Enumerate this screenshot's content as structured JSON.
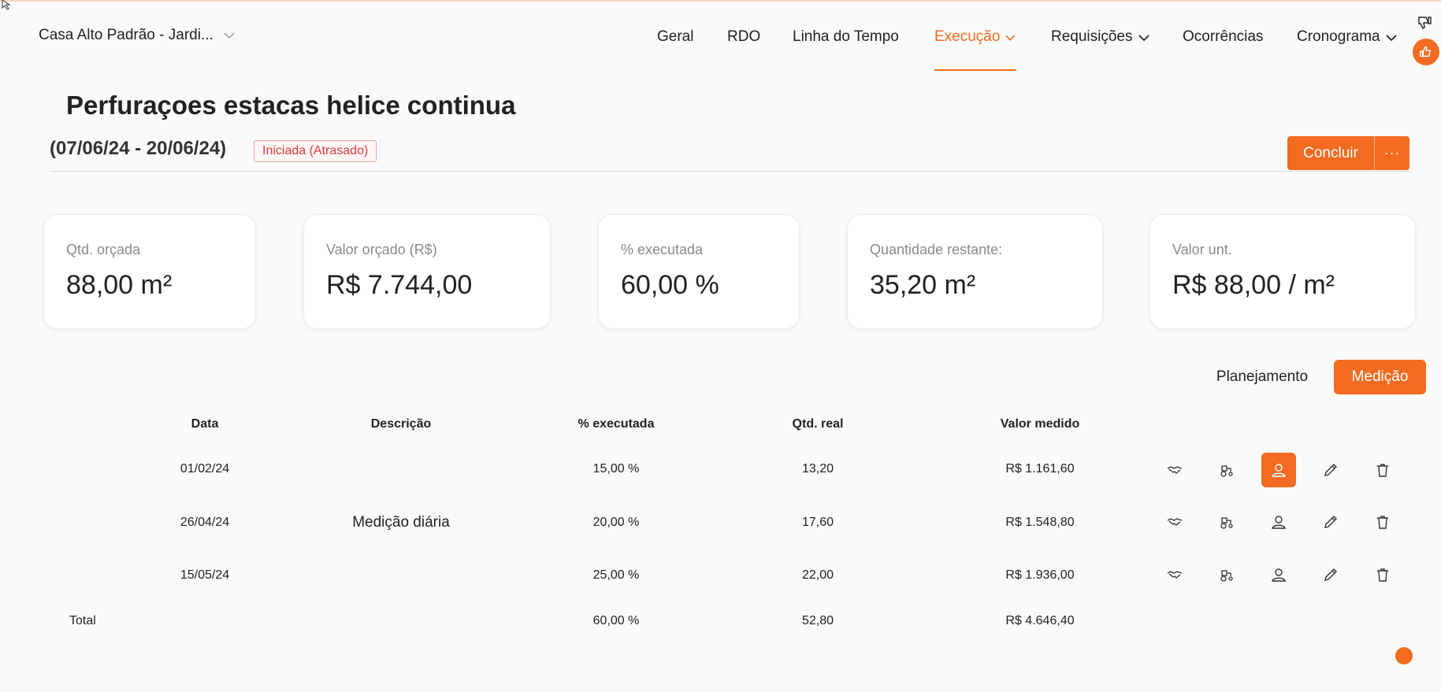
{
  "header": {
    "project_name": "Casa Alto Padrão - Jardi...",
    "nav": [
      {
        "label": "Geral"
      },
      {
        "label": "RDO"
      },
      {
        "label": "Linha do Tempo"
      },
      {
        "label": "Execução",
        "dropdown": true,
        "active": true
      },
      {
        "label": "Requisições",
        "dropdown": true
      },
      {
        "label": "Ocorrências"
      },
      {
        "label": "Cronograma",
        "dropdown": true
      }
    ]
  },
  "task": {
    "title": "Perfuraçoes estacas helice continua",
    "date_range": "(07/06/24 - 20/06/24)",
    "status": "Iniciada (Atrasado)",
    "conclude_label": "Concluir",
    "more_label": "···"
  },
  "stats": [
    {
      "label": "Qtd. orçada",
      "value": "88,00 m²"
    },
    {
      "label": "Valor orçado (R$)",
      "value": "R$ 7.744,00"
    },
    {
      "label": "% executada",
      "value": "60,00 %"
    },
    {
      "label": "Quantidade restante:",
      "value": "35,20 m²"
    },
    {
      "label": "Valor unt.",
      "value": "R$ 88,00 / m²"
    }
  ],
  "view_toggle": {
    "planning": "Planejamento",
    "measurement": "Medição",
    "active": "measurement"
  },
  "table": {
    "columns": [
      "Data",
      "Descrição",
      "% executada",
      "Qtd. real",
      "Valor medido"
    ],
    "rows": [
      {
        "date": "01/02/24",
        "description": "",
        "pct": "15,00 %",
        "qty": "13,20",
        "value": "R$ 1.161,60",
        "person_active": true
      },
      {
        "date": "26/04/24",
        "description": "Medição diária",
        "pct": "20,00 %",
        "qty": "17,60",
        "value": "R$ 1.548,80",
        "person_active": false
      },
      {
        "date": "15/05/24",
        "description": "",
        "pct": "25,00 %",
        "qty": "22,00",
        "value": "R$ 1.936,00",
        "person_active": false
      }
    ],
    "total": {
      "label": "Total",
      "pct": "60,00 %",
      "qty": "52,80",
      "value": "R$ 4.646,40"
    },
    "row_actions": [
      "handshake-icon",
      "tractor-icon",
      "user-icon",
      "pencil-icon",
      "trash-icon"
    ]
  },
  "colors": {
    "accent": "#f26b21",
    "status_red": "#e23b3b"
  }
}
